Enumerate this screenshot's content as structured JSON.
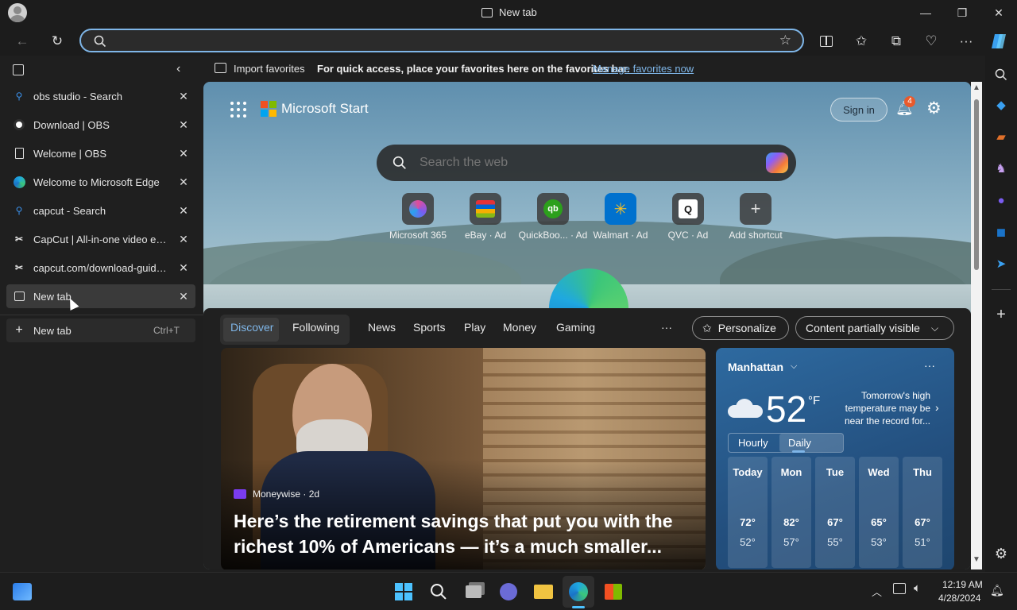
{
  "window": {
    "title": "New tab",
    "controls": {
      "minimize": "—",
      "restore": "❐",
      "close": "✕"
    }
  },
  "nav": {
    "address_value": "",
    "address_placeholder": ""
  },
  "favorites_bar": {
    "import_label": "Import favorites",
    "message": "For quick access, place your favorites here on the favorites bar.",
    "manage_link": "Manage favorites now"
  },
  "tabs": [
    {
      "label": "obs studio - Search",
      "icon": "search-icon"
    },
    {
      "label": "Download | OBS",
      "icon": "obs-icon"
    },
    {
      "label": "Welcome | OBS",
      "icon": "page-icon"
    },
    {
      "label": "Welcome to Microsoft Edge",
      "icon": "edge-icon"
    },
    {
      "label": "capcut - Search",
      "icon": "search-icon"
    },
    {
      "label": "CapCut | All-in-one video editor",
      "icon": "capcut-icon"
    },
    {
      "label": "capcut.com/download-guidance",
      "icon": "capcut-icon"
    },
    {
      "label": "New tab",
      "icon": "newtab-icon",
      "active": true
    }
  ],
  "new_tab": {
    "label": "New tab",
    "shortcut": "Ctrl+T"
  },
  "start": {
    "brand": "Microsoft Start",
    "sign_in": "Sign in",
    "notification_count": "4",
    "search_placeholder": "Search the web",
    "shortcuts": [
      {
        "label": "Microsoft 365",
        "icon": "m365-icon"
      },
      {
        "label": "eBay · Ad",
        "icon": "ebay-icon"
      },
      {
        "label": "QuickBoo... · Ad",
        "icon": "quickbooks-icon"
      },
      {
        "label": "Walmart · Ad",
        "icon": "walmart-icon"
      },
      {
        "label": "QVC · Ad",
        "icon": "qvc-icon"
      },
      {
        "label": "Add shortcut",
        "icon": "plus-icon"
      }
    ]
  },
  "feed": {
    "tabs": [
      "Discover",
      "Following",
      "News",
      "Sports",
      "Play",
      "Money",
      "Gaming"
    ],
    "more": "···",
    "personalize": "Personalize",
    "content_visibility": "Content partially visible"
  },
  "article": {
    "source": "Moneywise · 2d",
    "headline": "Here’s the retirement savings that put you with the richest 10% of Americans — it’s a much smaller..."
  },
  "weather": {
    "location": "Manhattan",
    "temp": "52",
    "unit": "°F",
    "note": "Tomorrow's high temperature may be near the record for...",
    "tab_hourly": "Hourly",
    "tab_daily": "Daily",
    "days": [
      {
        "day": "Today",
        "high": "72°",
        "low": "52°"
      },
      {
        "day": "Mon",
        "high": "82°",
        "low": "57°"
      },
      {
        "day": "Tue",
        "high": "67°",
        "low": "55°"
      },
      {
        "day": "Wed",
        "high": "65°",
        "low": "53°"
      },
      {
        "day": "Thu",
        "high": "67°",
        "low": "51°"
      }
    ]
  },
  "taskbar": {
    "time": "12:19 AM",
    "date": "4/28/2024"
  },
  "colors": {
    "accent": "#7fb6e8",
    "link": "#7fb6e8",
    "badge": "#e85a2c"
  }
}
